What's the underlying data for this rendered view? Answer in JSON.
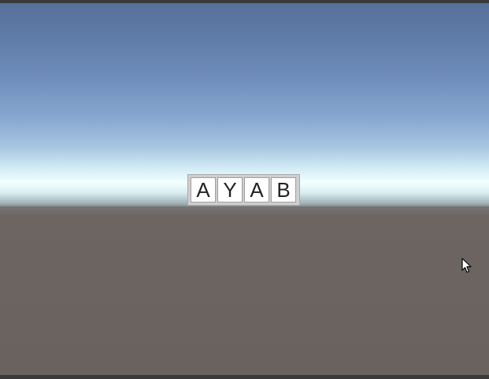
{
  "scene": {
    "letter_tiles": [
      {
        "letter": "A"
      },
      {
        "letter": "Y"
      },
      {
        "letter": "A"
      },
      {
        "letter": "B"
      }
    ],
    "colors": {
      "sky_top": "#56709a",
      "horizon_glow": "#f2ffff",
      "ground": "#6a625d",
      "tile_background": "#ffffff",
      "panel_background": "#cfcfcf"
    }
  },
  "cursor": {
    "icon": "mouse-pointer-icon"
  }
}
